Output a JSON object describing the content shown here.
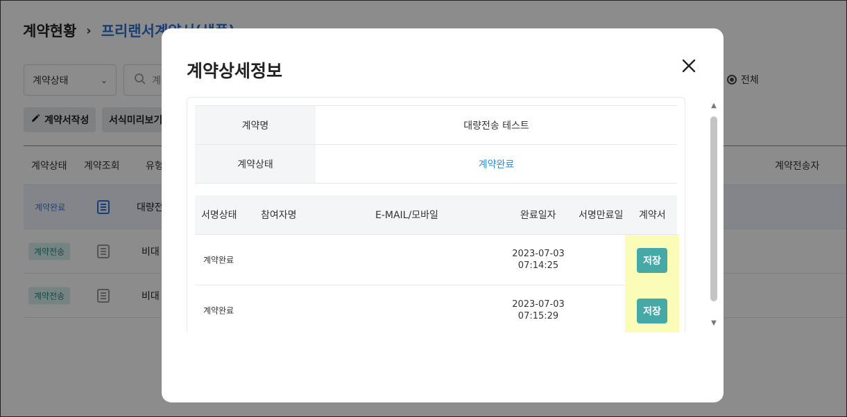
{
  "breadcrumb": {
    "root": "계약현황",
    "separator": "›",
    "current": "프리랜서계약서(샘플)"
  },
  "filters": {
    "status_select": "계약상태",
    "search_placeholder": "계",
    "radio_all_label": "전체"
  },
  "toolbar": {
    "write_label": "계약서작성",
    "preview_label": "서식미리보기"
  },
  "bg_table": {
    "headers": [
      "계약상태",
      "계약조회",
      "유형",
      "계약전송자"
    ],
    "rows": [
      {
        "status": "계약완료",
        "name": "대량전"
      },
      {
        "status": "계약전송",
        "name": "비대"
      },
      {
        "status": "계약전송",
        "name": "비대"
      }
    ]
  },
  "modal": {
    "title": "계약상세정보",
    "info": [
      {
        "label": "계약명",
        "value": "대량전송 테스트"
      },
      {
        "label": "계약상태",
        "value": "계약완료"
      }
    ],
    "sign_headers": [
      "서명상태",
      "참여자명",
      "E-MAIL/모바일",
      "완료일자",
      "서명만료일",
      "계약서"
    ],
    "sign_rows": [
      {
        "status": "계약완료",
        "date": "2023-07-03",
        "time": "07:14:25",
        "action": "저장"
      },
      {
        "status": "계약완료",
        "date": "2023-07-03",
        "time": "07:15:29",
        "action": "저장"
      }
    ]
  },
  "colors": {
    "accent": "#2f6fd6",
    "status_done": "#2f8fd6",
    "save_button": "#46a9a8",
    "highlight": "#fbfcb8"
  }
}
